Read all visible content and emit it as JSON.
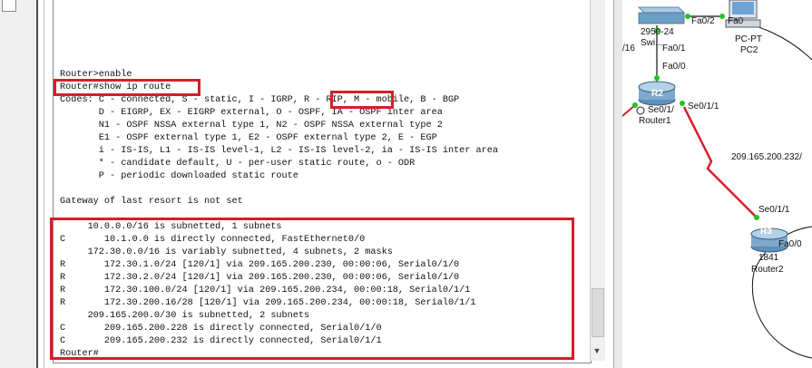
{
  "terminal": {
    "lines": [
      "Router>enable",
      "Router#show ip route",
      "Codes: C - connected, S - static, I - IGRP, R - RIP, M - mobile, B - BGP",
      "       D - EIGRP, EX - EIGRP external, O - OSPF, IA - OSPF inter area",
      "       N1 - OSPF NSSA external type 1, N2 - OSPF NSSA external type 2",
      "       E1 - OSPF external type 1, E2 - OSPF external type 2, E - EGP",
      "       i - IS-IS, L1 - IS-IS level-1, L2 - IS-IS level-2, ia - IS-IS inter area",
      "       * - candidate default, U - per-user static route, o - ODR",
      "       P - periodic downloaded static route",
      "",
      "Gateway of last resort is not set",
      "",
      "     10.0.0.0/16 is subnetted, 1 subnets",
      "C       10.1.0.0 is directly connected, FastEthernet0/0",
      "     172.30.0.0/16 is variably subnetted, 4 subnets, 2 masks",
      "R       172.30.1.0/24 [120/1] via 209.165.200.230, 00:00:06, Serial0/1/0",
      "R       172.30.2.0/24 [120/1] via 209.165.200.230, 00:00:06, Serial0/1/0",
      "R       172.30.100.0/24 [120/1] via 209.165.200.234, 00:00:18, Serial0/1/1",
      "R       172.30.200.16/28 [120/1] via 209.165.200.234, 00:00:18, Serial0/1/1",
      "     209.165.200.0/30 is subnetted, 2 subnets",
      "C       209.165.200.228 is directly connected, Serial0/1/0",
      "C       209.165.200.232 is directly connected, Serial0/1/1",
      "Router#"
    ]
  },
  "topology": {
    "switch_model": "2950-24",
    "switch_name": "Swi...",
    "switch_port_pc": "Fa0/2",
    "switch_port_router": "Fa0/1",
    "left_edge_text": "/16",
    "pc_port": "Fa0",
    "pc_model": "PC-PT",
    "pc_name": "PC2",
    "r1_port_fa": "Fa0/0",
    "r1_icon_label": "R2",
    "r1_port_se0": "Se0/1/",
    "r1_port_se1": "Se0/1/1",
    "r1_name": "Router1",
    "link_network": "209.165.200.232/",
    "r2_port_se": "Se0/1/1",
    "r2_icon_label": "R3",
    "r2_port_fa": "Fa0/0",
    "r2_model": "1841",
    "r2_name": "Router2",
    "colors": {
      "serial_link": "#d32027",
      "ethernet_link": "#111111",
      "port_up": "#22c322",
      "router_body": "#7fa9cc",
      "switch_body": "#6b9ec2"
    }
  },
  "highlights": {
    "color": "#d32027"
  }
}
